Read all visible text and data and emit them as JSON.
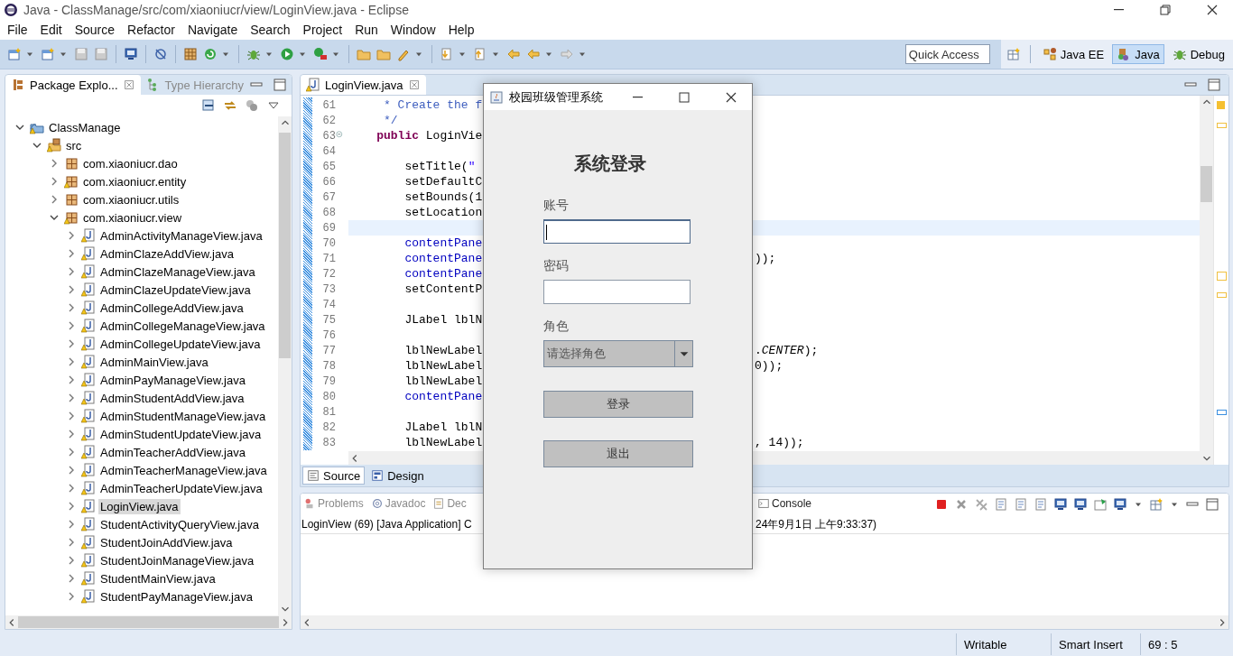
{
  "window": {
    "title": "Java - ClassManage/src/com/xiaoniucr/view/LoginView.java - Eclipse"
  },
  "menu": [
    "File",
    "Edit",
    "Source",
    "Refactor",
    "Navigate",
    "Search",
    "Project",
    "Run",
    "Window",
    "Help"
  ],
  "quick_access": {
    "placeholder": "Quick Access"
  },
  "perspectives": [
    {
      "label": "Java EE",
      "selected": false
    },
    {
      "label": "Java",
      "selected": true
    },
    {
      "label": "Debug",
      "selected": false
    }
  ],
  "explorer": {
    "tabs": [
      {
        "label": "Package Explo...",
        "selected": true
      },
      {
        "label": "Type Hierarchy",
        "selected": false
      }
    ],
    "tree": [
      {
        "label": "ClassManage",
        "kind": "project",
        "expanded": true,
        "children": [
          {
            "label": "src",
            "kind": "folder",
            "expanded": true,
            "children": [
              {
                "label": "com.xiaoniucr.dao",
                "kind": "package",
                "expanded": false,
                "warning": false
              },
              {
                "label": "com.xiaoniucr.entity",
                "kind": "package",
                "expanded": false,
                "warning": true
              },
              {
                "label": "com.xiaoniucr.utils",
                "kind": "package",
                "expanded": false,
                "warning": false
              },
              {
                "label": "com.xiaoniucr.view",
                "kind": "package",
                "expanded": true,
                "warning": true,
                "children": [
                  {
                    "label": "AdminActivityManageView.java",
                    "kind": "file",
                    "expanded": false,
                    "selected": false
                  },
                  {
                    "label": "AdminClazeAddView.java",
                    "kind": "file",
                    "expanded": false,
                    "selected": false
                  },
                  {
                    "label": "AdminClazeManageView.java",
                    "kind": "file",
                    "expanded": false,
                    "selected": false
                  },
                  {
                    "label": "AdminClazeUpdateView.java",
                    "kind": "file",
                    "expanded": false,
                    "selected": false
                  },
                  {
                    "label": "AdminCollegeAddView.java",
                    "kind": "file",
                    "expanded": false,
                    "selected": false
                  },
                  {
                    "label": "AdminCollegeManageView.java",
                    "kind": "file",
                    "expanded": false,
                    "selected": false
                  },
                  {
                    "label": "AdminCollegeUpdateView.java",
                    "kind": "file",
                    "expanded": false,
                    "selected": false
                  },
                  {
                    "label": "AdminMainView.java",
                    "kind": "file",
                    "expanded": false,
                    "selected": false
                  },
                  {
                    "label": "AdminPayManageView.java",
                    "kind": "file",
                    "expanded": false,
                    "selected": false
                  },
                  {
                    "label": "AdminStudentAddView.java",
                    "kind": "file",
                    "expanded": false,
                    "selected": false
                  },
                  {
                    "label": "AdminStudentManageView.java",
                    "kind": "file",
                    "expanded": false,
                    "selected": false
                  },
                  {
                    "label": "AdminStudentUpdateView.java",
                    "kind": "file",
                    "expanded": false,
                    "selected": false
                  },
                  {
                    "label": "AdminTeacherAddView.java",
                    "kind": "file",
                    "expanded": false,
                    "selected": false
                  },
                  {
                    "label": "AdminTeacherManageView.java",
                    "kind": "file",
                    "expanded": false,
                    "selected": false
                  },
                  {
                    "label": "AdminTeacherUpdateView.java",
                    "kind": "file",
                    "expanded": false,
                    "selected": false
                  },
                  {
                    "label": "LoginView.java",
                    "kind": "file",
                    "expanded": false,
                    "selected": true
                  },
                  {
                    "label": "StudentActivityQueryView.java",
                    "kind": "file",
                    "expanded": false,
                    "selected": false
                  },
                  {
                    "label": "StudentJoinAddView.java",
                    "kind": "file",
                    "expanded": false,
                    "selected": false
                  },
                  {
                    "label": "StudentJoinManageView.java",
                    "kind": "file",
                    "expanded": false,
                    "selected": false
                  },
                  {
                    "label": "StudentMainView.java",
                    "kind": "file",
                    "expanded": false,
                    "selected": false
                  },
                  {
                    "label": "StudentPayManageView.java",
                    "kind": "file",
                    "expanded": false,
                    "selected": false
                  }
                ]
              }
            ]
          }
        ]
      }
    ]
  },
  "editor": {
    "tab": "LoginView.java",
    "lines": [
      {
        "number": "61",
        "current": false,
        "fold": false,
        "code": [
          {
            "text": "     * Create the f",
            "kind": "comment"
          }
        ]
      },
      {
        "number": "62",
        "current": false,
        "fold": false,
        "code": [
          {
            "text": "     */",
            "kind": "comment"
          }
        ]
      },
      {
        "number": "63",
        "current": false,
        "fold": true,
        "code": [
          {
            "text": "    public",
            "kind": "keyword"
          },
          {
            "text": " LoginVie",
            "kind": "plain"
          }
        ]
      },
      {
        "number": "64",
        "current": false,
        "fold": false
      },
      {
        "number": "65",
        "current": false,
        "fold": false,
        "code": [
          {
            "text": "        setTitle(",
            "kind": "plain"
          },
          {
            "text": "\"",
            "kind": "string"
          }
        ]
      },
      {
        "number": "66",
        "current": false,
        "fold": false,
        "code": [
          {
            "text": "        setDefaultC",
            "kind": "plain"
          }
        ]
      },
      {
        "number": "67",
        "current": false,
        "fold": false,
        "code": [
          {
            "text": "        setBounds(1",
            "kind": "plain"
          }
        ]
      },
      {
        "number": "68",
        "current": false,
        "fold": false,
        "code": [
          {
            "text": "        setLocation",
            "kind": "plain"
          }
        ]
      },
      {
        "number": "69",
        "current": true,
        "fold": false
      },
      {
        "number": "70",
        "current": false,
        "fold": false,
        "code": [
          {
            "text": "        contentPane",
            "kind": "field"
          }
        ]
      },
      {
        "number": "71",
        "current": false,
        "fold": false,
        "code": [
          {
            "text": "        contentPane",
            "kind": "field"
          }
        ],
        "tail": "));"
      },
      {
        "number": "72",
        "current": false,
        "fold": false,
        "code": [
          {
            "text": "        contentPane",
            "kind": "field"
          }
        ]
      },
      {
        "number": "73",
        "current": false,
        "fold": false,
        "code": [
          {
            "text": "        setContentP",
            "kind": "plain"
          }
        ]
      },
      {
        "number": "74",
        "current": false,
        "fold": false
      },
      {
        "number": "75",
        "current": false,
        "fold": false,
        "code": [
          {
            "text": "        JLabel lblN",
            "kind": "plain"
          }
        ]
      },
      {
        "number": "76",
        "current": false,
        "fold": false
      },
      {
        "number": "77",
        "current": false,
        "fold": false,
        "code": [
          {
            "text": "        lblNewLabel",
            "kind": "plain"
          }
        ],
        "tail": ".*CENTER*);"
      },
      {
        "number": "78",
        "current": false,
        "fold": false,
        "code": [
          {
            "text": "        lblNewLabel",
            "kind": "plain"
          }
        ],
        "tail": "0));"
      },
      {
        "number": "79",
        "current": false,
        "fold": false,
        "code": [
          {
            "text": "        lblNewLabel",
            "kind": "plain"
          }
        ]
      },
      {
        "number": "80",
        "current": false,
        "fold": false,
        "code": [
          {
            "text": "        contentPane",
            "kind": "field"
          }
        ]
      },
      {
        "number": "81",
        "current": false,
        "fold": false
      },
      {
        "number": "82",
        "current": false,
        "fold": false,
        "code": [
          {
            "text": "        JLabel lblN",
            "kind": "plain"
          }
        ]
      },
      {
        "number": "83",
        "current": false,
        "fold": false,
        "code": [
          {
            "text": "        lblNewLabel",
            "kind": "plain"
          }
        ],
        "tail": ", 14));"
      }
    ],
    "bottom_tabs": [
      {
        "label": "Source",
        "selected": true
      },
      {
        "label": "Design",
        "selected": false
      }
    ]
  },
  "console": {
    "tabs": [
      {
        "label": "Problems",
        "selected": false
      },
      {
        "label": "Javadoc",
        "selected": false
      },
      {
        "label": "Dec",
        "selected": false
      },
      {
        "label": "Console",
        "selected": true
      }
    ],
    "line_left": "LoginView (69) [Java Application] C",
    "line_right": "24年9月1日 上午9:33:37)"
  },
  "dialog": {
    "title": "校园班级管理系统",
    "heading": "系统登录",
    "fields": [
      {
        "label": "账号",
        "focused": true
      },
      {
        "label": "密码",
        "focused": false
      }
    ],
    "role": {
      "label": "角色",
      "value": "请选择角色"
    },
    "buttons": [
      "登录",
      "退出"
    ]
  },
  "status_bar": [
    "Writable",
    "Smart Insert",
    "69 : 5"
  ]
}
